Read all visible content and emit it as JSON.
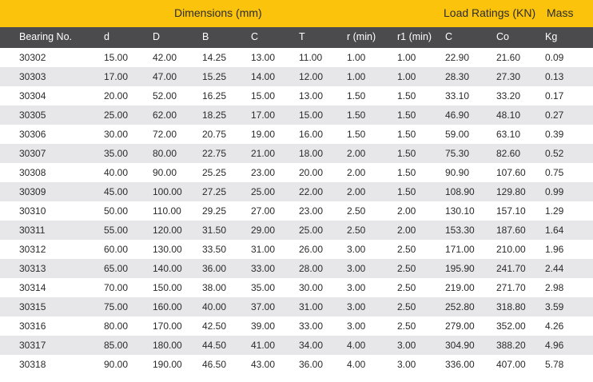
{
  "group_headers": {
    "dimensions": "Dimensions (mm)",
    "load_ratings": "Load Ratings (KN)",
    "mass": "Mass"
  },
  "colors": {
    "accent": "#fcc30d",
    "header_bg": "#4b4b4d",
    "stripe": "#e7e7e9"
  },
  "columns": [
    "Bearing No.",
    "d",
    "D",
    "B",
    "C",
    "T",
    "r (min)",
    "r1 (min)",
    "C",
    "Co",
    "Kg"
  ],
  "rows": [
    [
      "30302",
      "15.00",
      "42.00",
      "14.25",
      "13.00",
      "11.00",
      "1.00",
      "1.00",
      "22.90",
      "21.60",
      "0.09"
    ],
    [
      "30303",
      "17.00",
      "47.00",
      "15.25",
      "14.00",
      "12.00",
      "1.00",
      "1.00",
      "28.30",
      "27.30",
      "0.13"
    ],
    [
      "30304",
      "20.00",
      "52.00",
      "16.25",
      "15.00",
      "13.00",
      "1.50",
      "1.50",
      "33.10",
      "33.20",
      "0.17"
    ],
    [
      "30305",
      "25.00",
      "62.00",
      "18.25",
      "17.00",
      "15.00",
      "1.50",
      "1.50",
      "46.90",
      "48.10",
      "0.27"
    ],
    [
      "30306",
      "30.00",
      "72.00",
      "20.75",
      "19.00",
      "16.00",
      "1.50",
      "1.50",
      "59.00",
      "63.10",
      "0.39"
    ],
    [
      "30307",
      "35.00",
      "80.00",
      "22.75",
      "21.00",
      "18.00",
      "2.00",
      "1.50",
      "75.30",
      "82.60",
      "0.52"
    ],
    [
      "30308",
      "40.00",
      "90.00",
      "25.25",
      "23.00",
      "20.00",
      "2.00",
      "1.50",
      "90.90",
      "107.60",
      "0.75"
    ],
    [
      "30309",
      "45.00",
      "100.00",
      "27.25",
      "25.00",
      "22.00",
      "2.00",
      "1.50",
      "108.90",
      "129.80",
      "0.99"
    ],
    [
      "30310",
      "50.00",
      "110.00",
      "29.25",
      "27.00",
      "23.00",
      "2.50",
      "2.00",
      "130.10",
      "157.10",
      "1.29"
    ],
    [
      "30311",
      "55.00",
      "120.00",
      "31.50",
      "29.00",
      "25.00",
      "2.50",
      "2.00",
      "153.30",
      "187.60",
      "1.64"
    ],
    [
      "30312",
      "60.00",
      "130.00",
      "33.50",
      "31.00",
      "26.00",
      "3.00",
      "2.50",
      "171.00",
      "210.00",
      "1.96"
    ],
    [
      "30313",
      "65.00",
      "140.00",
      "36.00",
      "33.00",
      "28.00",
      "3.00",
      "2.50",
      "195.90",
      "241.70",
      "2.44"
    ],
    [
      "30314",
      "70.00",
      "150.00",
      "38.00",
      "35.00",
      "30.00",
      "3.00",
      "2.50",
      "219.00",
      "271.70",
      "2.98"
    ],
    [
      "30315",
      "75.00",
      "160.00",
      "40.00",
      "37.00",
      "31.00",
      "3.00",
      "2.50",
      "252.80",
      "318.80",
      "3.59"
    ],
    [
      "30316",
      "80.00",
      "170.00",
      "42.50",
      "39.00",
      "33.00",
      "3.00",
      "2.50",
      "279.00",
      "352.00",
      "4.26"
    ],
    [
      "30317",
      "85.00",
      "180.00",
      "44.50",
      "41.00",
      "34.00",
      "4.00",
      "3.00",
      "304.90",
      "388.20",
      "4.96"
    ],
    [
      "30318",
      "90.00",
      "190.00",
      "46.50",
      "43.00",
      "36.00",
      "4.00",
      "3.00",
      "336.00",
      "407.00",
      "5.78"
    ]
  ]
}
